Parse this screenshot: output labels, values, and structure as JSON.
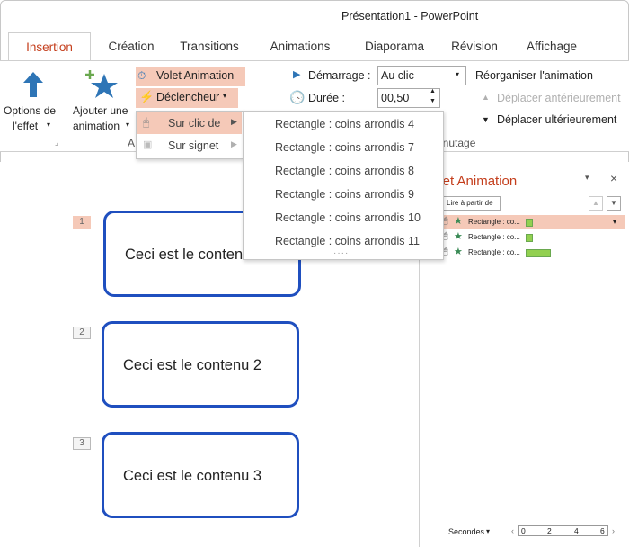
{
  "window": {
    "title": "Présentation1 - PowerPoint"
  },
  "tabs": [
    {
      "label": "Insertion"
    },
    {
      "label": "Création"
    },
    {
      "label": "Transitions"
    },
    {
      "label": "Animations"
    },
    {
      "label": "Diaporama"
    },
    {
      "label": "Révision"
    },
    {
      "label": "Affichage"
    }
  ],
  "ribbon": {
    "effect_options_line1": "Options de",
    "effect_options_line2": "l'effet",
    "add_animation_line1": "Ajouter une",
    "add_animation_line2": "animation",
    "group_label_partial": "A",
    "animation_pane_label": "Volet Animation",
    "trigger_label": "Déclencheur",
    "start_label": "Démarrage :",
    "start_value": "Au clic",
    "duration_label": "Durée :",
    "duration_value": "00,50",
    "reorder_title": "Réorganiser l'animation",
    "move_earlier": "Déplacer antérieurement",
    "move_later": "Déplacer ultérieurement",
    "timing_group_partial": "inutage"
  },
  "trigger_menu": {
    "on_click_of": "Sur clic de",
    "on_bookmark": "Sur signet",
    "more": "····",
    "items": [
      "Rectangle : coins arrondis 4",
      "Rectangle : coins arrondis 7",
      "Rectangle : coins arrondis 8",
      "Rectangle : coins arrondis 9",
      "Rectangle : coins arrondis 10",
      "Rectangle : coins arrondis 11"
    ]
  },
  "slide": {
    "shapes": [
      {
        "tag": "1",
        "text": "Ceci est le contenu 1"
      },
      {
        "tag": "2",
        "text": "Ceci est le contenu 2"
      },
      {
        "tag": "3",
        "text": "Ceci est le contenu 3"
      }
    ]
  },
  "pane": {
    "title": "olet Animation",
    "play_from": "Lire à partir de",
    "items": [
      {
        "label": "Rectangle : co..."
      },
      {
        "label": "Rectangle : co..."
      },
      {
        "label": "Rectangle : co..."
      }
    ],
    "seconds_label": "Secondes",
    "timeline_ticks": [
      "0",
      "2",
      "4",
      "6"
    ]
  },
  "colors": {
    "accent": "#c43e1c",
    "highlight": "#f5c9b8",
    "shape_border": "#1f4fbf",
    "timing_bar": "#92d050"
  }
}
